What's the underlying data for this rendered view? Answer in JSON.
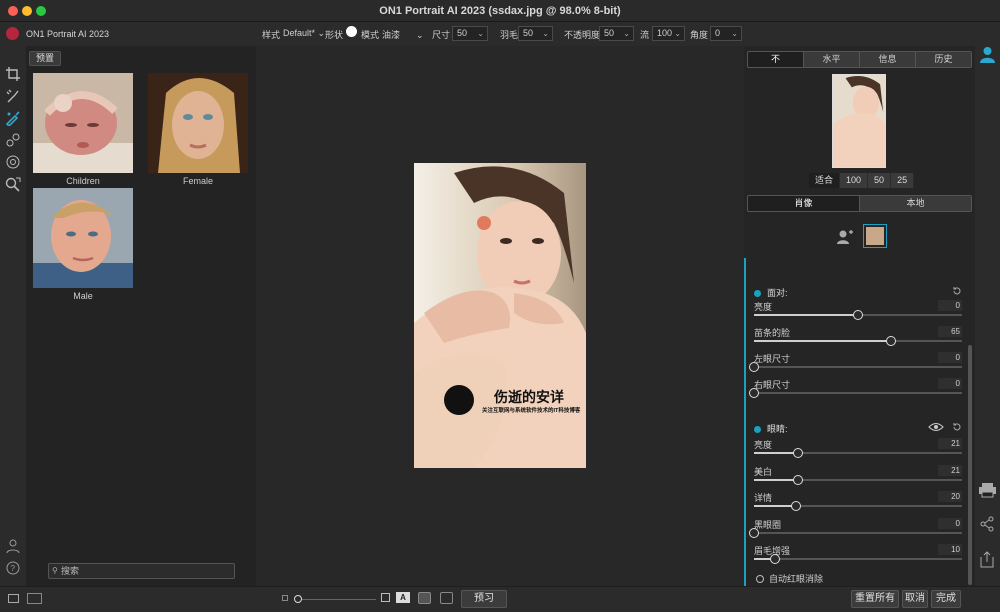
{
  "window": {
    "title": "ON1 Portrait AI 2023 (ssdax.jpg @ 98.0% 8-bit)",
    "traffic_colors": [
      "#fe5f57",
      "#febc2e",
      "#28c840"
    ]
  },
  "app": {
    "name": "ON1 Portrait AI 2023",
    "brand_color": "#b3263b",
    "accent_color": "#1ea0c0"
  },
  "toolbar": {
    "style_label": "样式",
    "style_value": "Default*",
    "shape_label": "形状",
    "mode_label": "模式",
    "mode_value": "油漆",
    "size_label": "尺寸",
    "size_value": "50",
    "feather_label": "羽毛",
    "feather_value": "50",
    "opacity_label": "不透明度",
    "opacity_value": "50",
    "flow_label": "流",
    "flow_value": "100",
    "angle_label": "角度",
    "angle_value": "0"
  },
  "presets": {
    "button": "预置",
    "items": [
      {
        "label": "Children"
      },
      {
        "label": "Female"
      },
      {
        "label": "Male"
      }
    ],
    "search_placeholder": "搜索"
  },
  "watermark": {
    "title": "伤逝的安详",
    "subtitle": "关注互联网与系统软件技术的IT科技博客"
  },
  "right": {
    "top_tabs": [
      "不",
      "水平",
      "信息",
      "历史"
    ],
    "zoom_options": [
      "适合",
      "100",
      "50",
      "25"
    ],
    "mode_tabs": [
      "肖像",
      "本地"
    ],
    "face": {
      "title": "面对:",
      "sliders": [
        {
          "label": "亮度",
          "value": "0",
          "pct": 0.5
        },
        {
          "label": "苗条的脸",
          "value": "65",
          "pct": 0.66
        },
        {
          "label": "左眼尺寸",
          "value": "0",
          "pct": 0.0
        },
        {
          "label": "右眼尺寸",
          "value": "0",
          "pct": 0.0
        }
      ]
    },
    "eyes": {
      "title": "眼睛:",
      "sliders": [
        {
          "label": "亮度",
          "value": "21",
          "pct": 0.21
        },
        {
          "label": "美白",
          "value": "21",
          "pct": 0.21
        },
        {
          "label": "详情",
          "value": "20",
          "pct": 0.2
        },
        {
          "label": "黑眼圈",
          "value": "0",
          "pct": 0.0
        },
        {
          "label": "眉毛增强",
          "value": "10",
          "pct": 0.1
        }
      ],
      "checkbox": "自动红眼消除"
    }
  },
  "bottom": {
    "preview_button": "预习",
    "reset_all": "重置所有",
    "cancel": "取消",
    "done": "完成"
  }
}
